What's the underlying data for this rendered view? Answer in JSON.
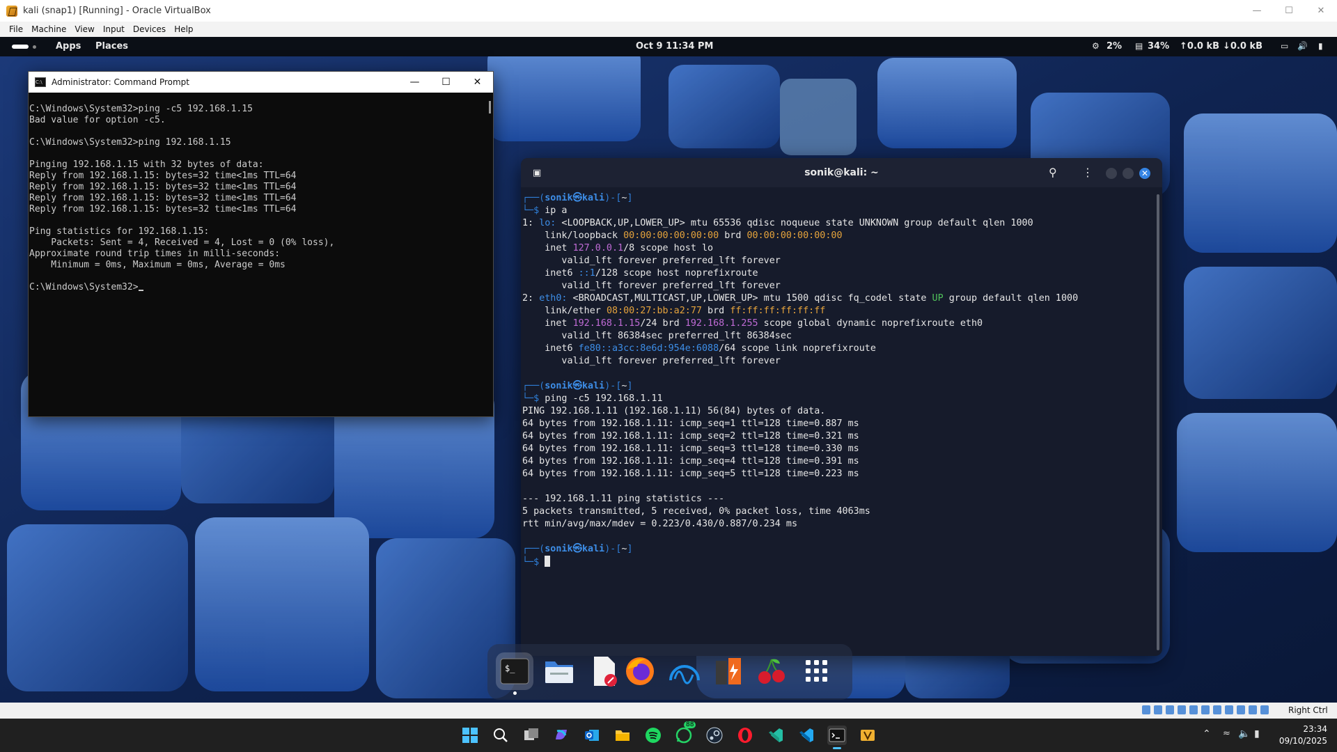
{
  "vbox": {
    "title": "kali (snap1) [Running] - Oracle VirtualBox",
    "menu": [
      "File",
      "Machine",
      "View",
      "Input",
      "Devices",
      "Help"
    ],
    "status_right": "Right Ctrl"
  },
  "topbar": {
    "apps": "Apps",
    "places": "Places",
    "datetime": "Oct 9  11:34 PM",
    "cpu": "2%",
    "mem": "34%",
    "net_up": "↑0.0 kB",
    "net_down": "↓0.0 kB"
  },
  "cmd": {
    "title": "Administrator: Command Prompt",
    "lines": [
      "",
      "C:\\Windows\\System32>ping -c5 192.168.1.15",
      "Bad value for option -c5.",
      "",
      "C:\\Windows\\System32>ping 192.168.1.15",
      "",
      "Pinging 192.168.1.15 with 32 bytes of data:",
      "Reply from 192.168.1.15: bytes=32 time<1ms TTL=64",
      "Reply from 192.168.1.15: bytes=32 time<1ms TTL=64",
      "Reply from 192.168.1.15: bytes=32 time<1ms TTL=64",
      "Reply from 192.168.1.15: bytes=32 time<1ms TTL=64",
      "",
      "Ping statistics for 192.168.1.15:",
      "    Packets: Sent = 4, Received = 4, Lost = 0 (0% loss),",
      "Approximate round trip times in milli-seconds:",
      "    Minimum = 0ms, Maximum = 0ms, Average = 0ms",
      "",
      "C:\\Windows\\System32>"
    ]
  },
  "kali": {
    "title": "sonik@kali: ~",
    "user": "sonik",
    "host": "kali",
    "dir": "~",
    "cmd1": "ip a",
    "lo": {
      "idx": "1: ",
      "name": "lo:",
      "rest": " <LOOPBACK,UP,LOWER_UP> mtu 65536 qdisc noqueue state UNKNOWN group default qlen 1000",
      "link_pre": "    link/loopback ",
      "mac": "00:00:00:00:00:00",
      "brd": " brd ",
      "brd_mac": "00:00:00:00:00:00",
      "inet_pre": "    inet ",
      "inet": "127.0.0.1",
      "inet_post": "/8 scope host lo",
      "valid1": "       valid_lft forever preferred_lft forever",
      "inet6_pre": "    inet6 ",
      "inet6": "::1",
      "inet6_post": "/128 scope host noprefixroute",
      "valid2": "       valid_lft forever preferred_lft forever"
    },
    "eth0": {
      "idx": "2: ",
      "name": "eth0:",
      "rest_a": " <BROADCAST,MULTICAST,UP,LOWER_UP> mtu 1500 qdisc fq_codel state ",
      "up": "UP",
      "rest_b": " group default qlen 1000",
      "link_pre": "    link/ether ",
      "mac": "08:00:27:bb:a2:77",
      "brd": " brd ",
      "brd_mac": "ff:ff:ff:ff:ff:ff",
      "inet_pre": "    inet ",
      "inet": "192.168.1.15",
      "inet_mid": "/24 brd ",
      "inet_brd": "192.168.1.255",
      "inet_post": " scope global dynamic noprefixroute eth0",
      "valid1": "       valid_lft 86384sec preferred_lft 86384sec",
      "inet6_pre": "    inet6 ",
      "inet6": "fe80::a3cc:8e6d:954e:6088",
      "inet6_post": "/64 scope link noprefixroute",
      "valid2": "       valid_lft forever preferred_lft forever"
    },
    "cmd2": "ping -c5 192.168.1.11",
    "ping_lines": [
      "PING 192.168.1.11 (192.168.1.11) 56(84) bytes of data.",
      "64 bytes from 192.168.1.11: icmp_seq=1 ttl=128 time=0.887 ms",
      "64 bytes from 192.168.1.11: icmp_seq=2 ttl=128 time=0.321 ms",
      "64 bytes from 192.168.1.11: icmp_seq=3 ttl=128 time=0.330 ms",
      "64 bytes from 192.168.1.11: icmp_seq=4 ttl=128 time=0.391 ms",
      "64 bytes from 192.168.1.11: icmp_seq=5 ttl=128 time=0.223 ms",
      "",
      "--- 192.168.1.11 ping statistics ---",
      "5 packets transmitted, 5 received, 0% packet loss, time 4063ms",
      "rtt min/avg/max/mdev = 0.223/0.430/0.887/0.234 ms"
    ]
  },
  "dock": {
    "items": [
      "terminal",
      "files",
      "text-editor",
      "firefox",
      "wireshark",
      "burpsuite",
      "cherrytree",
      "app-grid"
    ]
  },
  "taskbar": {
    "apps": [
      "start",
      "search",
      "task-view",
      "copilot",
      "outlook",
      "file-explorer",
      "spotify",
      "whatsapp",
      "steam",
      "opera",
      "vscode-insiders",
      "vscode",
      "terminal",
      "virtualbox"
    ],
    "whatsapp_badge": "88",
    "time": "23:34",
    "date": "09/10/2025"
  }
}
